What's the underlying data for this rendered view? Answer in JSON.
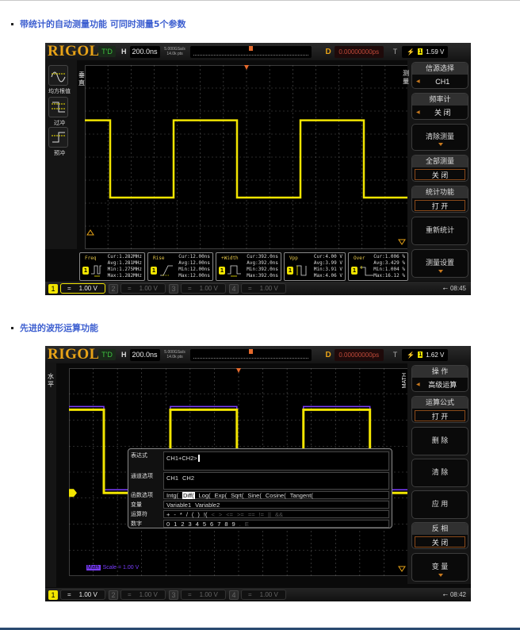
{
  "section1": {
    "heading": "带统计的自动测量功能  可同时测量5个参数"
  },
  "section2": {
    "heading": "先进的波形运算功能"
  },
  "scope1": {
    "logo": "RIGOL",
    "run_state": "T'D",
    "horizontal_label": "H",
    "timebase": "200.0ns",
    "sample_rate": "5.000GSa/s",
    "memory_depth": "14.0k pts",
    "delay_label": "D",
    "delay": "0.00000000ps",
    "trigger_label": "T",
    "trigger_edge": "rising-edge",
    "trigger_source": "1",
    "trigger_level": "1.59 V",
    "left_tab": "垂直",
    "left_buttons": [
      {
        "label": "均方根值",
        "icon": "rms-icon"
      },
      {
        "label": "过冲",
        "icon": "overshoot-icon"
      },
      {
        "label": "预冲",
        "icon": "preshoot-icon"
      }
    ],
    "right_tab": "测量",
    "menu": [
      {
        "title": "信源选择",
        "value": "CH1",
        "has_arrow": true
      },
      {
        "title": "频率计",
        "value": "关  闭",
        "has_arrow": true
      },
      {
        "label": "清除测量",
        "has_down": true
      },
      {
        "title": "全部测量",
        "value": "关  闭",
        "boxed": true
      },
      {
        "title": "统计功能",
        "value": "打  开",
        "boxed": true
      },
      {
        "label": "重新统计"
      },
      {
        "label": "测量设置",
        "has_down": true
      }
    ],
    "measurements": [
      {
        "name": "Freq",
        "cur": "Cur:1.282MHz",
        "avg": "Avg:1.281MHz",
        "min": "Min:1.275MHz",
        "max": "Max:1.282MHz"
      },
      {
        "name": "Rise",
        "cur": "Cur:12.00ns",
        "avg": "Avg:12.00ns",
        "min": "Min:12.00ns",
        "max": "Max:12.00ns"
      },
      {
        "name": "+Width",
        "cur": "Cur:392.0ns",
        "avg": "Avg:392.0ns",
        "min": "Min:392.0ns",
        "max": "Max:392.0ns"
      },
      {
        "name": "Vpp",
        "cur": "Cur:4.00 V",
        "avg": "Avg:3.99 V",
        "min": "Min:3.91 V",
        "max": "Max:4.06 V"
      },
      {
        "name": "Over",
        "cur": "Cur:1.006 %",
        "avg": "Avg:3.429 %",
        "min": "Min:1.004 %",
        "max": "Max:16.12 %"
      }
    ],
    "channels": [
      {
        "num": "1",
        "coupling": "=",
        "scale": "1.00 V",
        "state": "active"
      },
      {
        "num": "2",
        "coupling": "=",
        "scale": "1.00 V",
        "state": "off"
      },
      {
        "num": "3",
        "coupling": "=",
        "scale": "1.00 V",
        "state": "off"
      },
      {
        "num": "4",
        "coupling": "=",
        "scale": "1.00 V",
        "state": "off"
      }
    ],
    "time": "08:45",
    "colors": {
      "ch1": "#f2e500",
      "logo": "#e8a317"
    }
  },
  "scope2": {
    "logo": "RIGOL",
    "run_state": "T'D",
    "horizontal_label": "H",
    "timebase": "200.0ns",
    "sample_rate": "5.000GSa/s",
    "memory_depth": "14.0k pts",
    "delay_label": "D",
    "delay": "0.00000000ps",
    "trigger_label": "T",
    "trigger_edge": "rising-edge",
    "trigger_source": "1",
    "trigger_level": "1.62 V",
    "left_tab": "水平",
    "right_tab": "MATH",
    "menu": [
      {
        "title": "操  作",
        "value": "高级运算",
        "has_arrow": true
      },
      {
        "title": "运算公式",
        "value": "打  开",
        "boxed": true
      },
      {
        "label": "删  除"
      },
      {
        "label": "清  除"
      },
      {
        "label": "应  用"
      },
      {
        "title": "反  相",
        "value": "关  闭",
        "boxed": true
      },
      {
        "label": "变  量",
        "has_down": true
      }
    ],
    "dialog": {
      "expression_label": "表达式",
      "expression": "CH1+CH2>",
      "channel_label": "通道选项",
      "channel_options": [
        "CH1",
        "CH2"
      ],
      "function_label": "函数选项",
      "functions": [
        "Intg(",
        "Diff(",
        "Log(",
        "Exp(",
        "Sqrt(",
        "Sine(",
        "Cosine(",
        "Tangent("
      ],
      "selected_function": "Diff(",
      "variable_label": "变量",
      "variables": [
        "Variable1",
        "Variable2"
      ],
      "operator_label": "运算符",
      "operators_enabled": [
        "+",
        "-",
        "*",
        "/",
        "(",
        ")",
        "!("
      ],
      "operators_disabled": [
        "<",
        ">",
        "<=",
        ">=",
        "==",
        "!=",
        "||",
        "&&"
      ],
      "digit_label": "数字",
      "digits": [
        "0",
        "1",
        "2",
        "3",
        "4",
        "5",
        "6",
        "7",
        "8",
        "9"
      ],
      "digits_disabled": [
        ".",
        "E"
      ]
    },
    "math_tag": "Math",
    "math_scale": "Scale = 1.00 V",
    "channels": [
      {
        "num": "1",
        "coupling": "=",
        "scale": "1.00 V",
        "state": "on"
      },
      {
        "num": "2",
        "coupling": "=",
        "scale": "1.00 V",
        "state": "off"
      },
      {
        "num": "3",
        "coupling": "=",
        "scale": "1.00 V",
        "state": "off"
      },
      {
        "num": "4",
        "coupling": "=",
        "scale": "1.00 V",
        "state": "off"
      }
    ],
    "time": "08:42",
    "colors": {
      "ch1": "#f2e500",
      "math": "#7a3cff"
    }
  }
}
